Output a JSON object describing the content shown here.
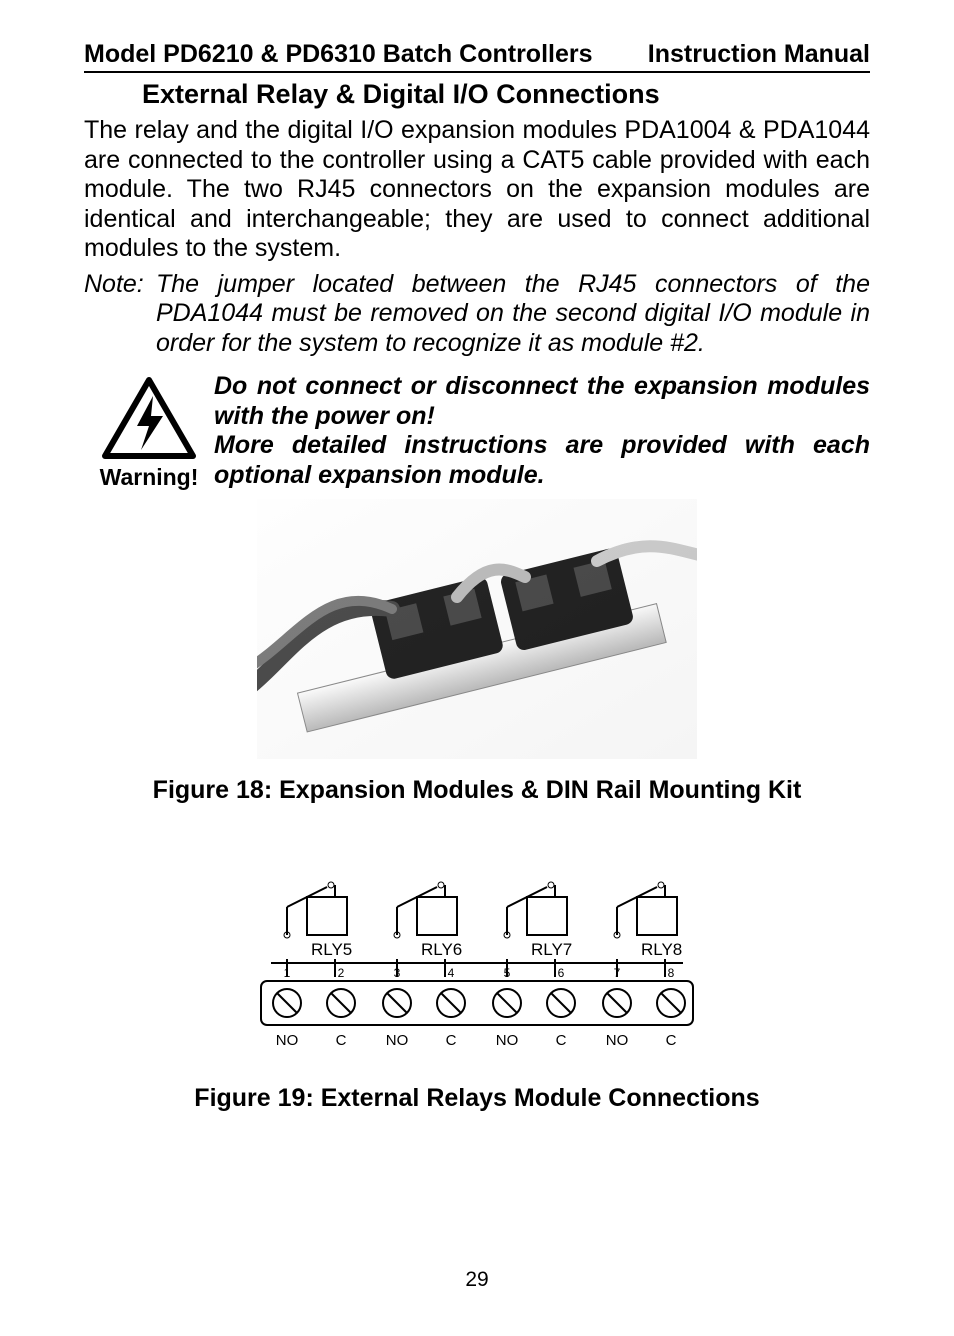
{
  "header": {
    "left": "Model PD6210 & PD6310 Batch Controllers",
    "right": "Instruction Manual"
  },
  "section_title": "External Relay & Digital I/O Connections",
  "body_para": "The relay and the digital I/O expansion modules PDA1004 & PDA1044 are connected to the controller using a CAT5 cable provided with each module. The two RJ45 connectors on the expansion modules are identical and interchangeable; they are used to connect additional modules to the system.",
  "note": {
    "label": "Note:",
    "text": "The jumper located between the RJ45 connectors of the PDA1044 must be removed on the second digital I/O module in order for the system to recognize it as module #2."
  },
  "warning": {
    "label": "Warning!",
    "line1": "Do not connect or disconnect the expansion modules with the power on!",
    "line2": "More detailed instructions are provided with each optional expansion module."
  },
  "figure18_caption": "Figure 18: Expansion Modules & DIN Rail Mounting Kit",
  "figure19_caption": "Figure 19: External Relays Module Connections",
  "relays": {
    "labels": [
      "RLY5",
      "RLY6",
      "RLY7",
      "RLY8"
    ],
    "top_nums": [
      "1",
      "2",
      "3",
      "4",
      "5",
      "6",
      "7",
      "8"
    ],
    "bottom_labels": [
      "NO",
      "C",
      "NO",
      "C",
      "NO",
      "C",
      "NO",
      "C"
    ]
  },
  "page_number": "29"
}
